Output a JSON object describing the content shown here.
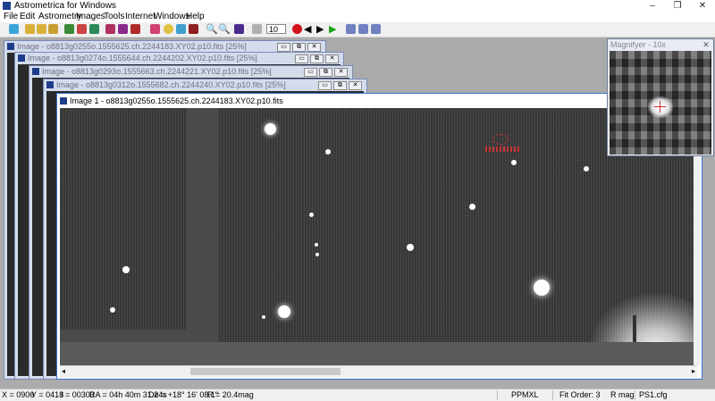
{
  "app": {
    "title": "Astrometrica for Windows",
    "icon": "astrometrica-logo-icon",
    "window_controls": [
      "–",
      "❐",
      "✕"
    ]
  },
  "menu": [
    "File",
    "Edit",
    "Astrometry",
    "Images",
    "Tools",
    "Internet",
    "Windows",
    "Help"
  ],
  "toolbar": {
    "zoom_value": "10",
    "buttons": [
      "connect-icon",
      "open-images-icon",
      "load-images-icon",
      "load-dark-icon",
      "save-icon",
      "data-reduction-icon",
      "calibrate-icon",
      "star-catalog-icon",
      "mpc-report-icon",
      "remove-icon",
      "settings-icon",
      "magnifier-icon",
      "zoom-in-icon",
      "zoom-out-icon",
      "blink-icon",
      "stack-icon",
      "record-icon",
      "previous-icon",
      "next-icon",
      "play-icon",
      "grid-layout-icon",
      "cascade-icon",
      "tile-icon"
    ]
  },
  "windows": [
    {
      "title": "Image - o8813g0255o.1555625.ch.2244183.XY02.p10.fits [25%]",
      "buttons": [
        "▭",
        "⧉",
        "✕"
      ]
    },
    {
      "title": "Image - o8813g0274o.1555644.ch.2244202.XY02.p10.fits [25%]",
      "buttons": [
        "▭",
        "⧉",
        "✕"
      ]
    },
    {
      "title": "Image - o8813g0293o.1555663.ch.2244221.XY02.p10.fits [25%]",
      "buttons": [
        "▭",
        "⧉",
        "✕"
      ]
    },
    {
      "title": "Image - o8813g0312o.1555682.ch.2244240.XY02.p10.fits [25%]",
      "buttons": [
        "▭",
        "⧉",
        "✕"
      ]
    },
    {
      "title": "Image 1 - o8813g0255o.1555625.ch.2244183.XY02.p10.fits",
      "buttons": [
        "▭",
        "⧉",
        "✕"
      ]
    }
  ],
  "magnifier": {
    "title": "Magnifyer - 10x",
    "close": "✕"
  },
  "status": {
    "x": "X = 0906",
    "y": "Y = 0418",
    "i": "I = 00303",
    "ra": "RA = 04h 40m 31.24s",
    "de": "De = +18° 16' 08.1\"",
    "r": "R = 20.4mag",
    "catalog": "PPMXL",
    "fit_order": "Fit Order: 3",
    "band": "R mag",
    "config": "PS1.cfg"
  },
  "colors": {
    "accent": "#3d6fd0",
    "record": "#d0101a",
    "play": "#1aa01a",
    "target_marker": "#c83232"
  }
}
